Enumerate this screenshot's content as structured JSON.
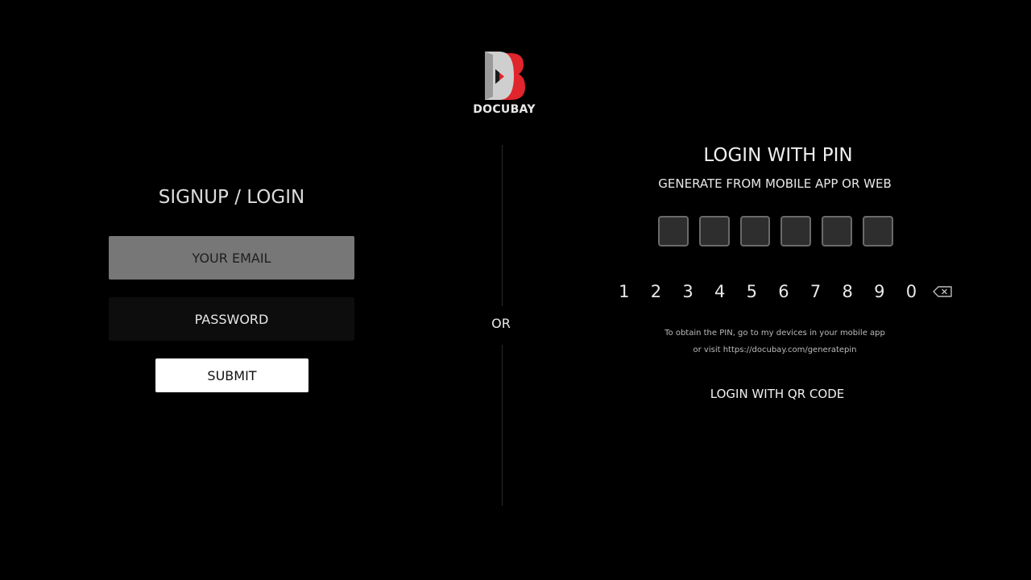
{
  "brand": {
    "name": "DOCUBAY",
    "logo_icon": "docubay-logo-icon",
    "colors": {
      "accent_red": "#e0252c",
      "logo_silver": "#c8c8c8"
    }
  },
  "left": {
    "title": "SIGNUP / LOGIN",
    "email_placeholder": "YOUR EMAIL",
    "password_placeholder": "PASSWORD",
    "submit_label": "SUBMIT"
  },
  "divider": {
    "or_label": "OR"
  },
  "pin": {
    "title": "LOGIN WITH PIN",
    "subtitle": "GENERATE FROM MOBILE APP OR WEB",
    "boxes": [
      "",
      "",
      "",
      "",
      "",
      ""
    ],
    "keys": [
      "1",
      "2",
      "3",
      "4",
      "5",
      "6",
      "7",
      "8",
      "9",
      "0"
    ],
    "backspace_icon": "backspace-icon",
    "hint_line1": "To obtain the PIN, go to my devices in your mobile app",
    "hint_line2": "or visit https://docubay.com/generatepin",
    "qr_link": "LOGIN WITH QR CODE"
  }
}
